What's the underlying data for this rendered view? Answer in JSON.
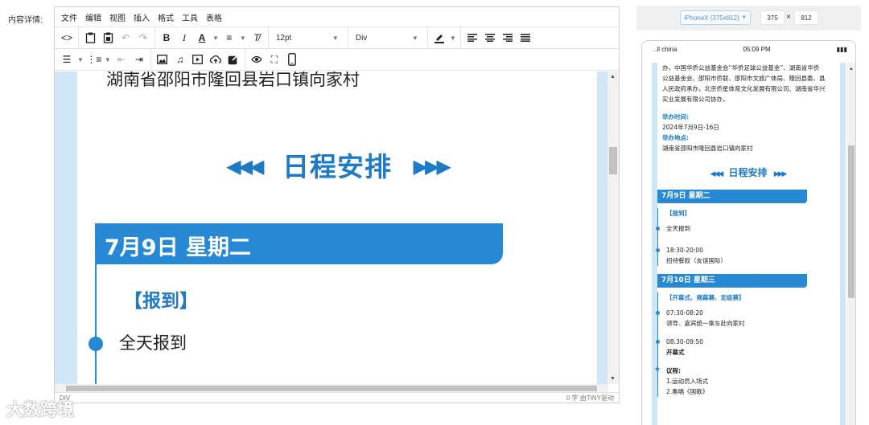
{
  "field_label": "内容详情:",
  "menubar": [
    "文件",
    "编辑",
    "视图",
    "插入",
    "格式",
    "工具",
    "表格"
  ],
  "toolbar": {
    "font_size": "12pt",
    "block_format": "Div"
  },
  "editor_content": {
    "address_line": "湖南省邵阳市隆回县岩口镇向家村",
    "schedule_title": "日程安排",
    "arrow_left": "◀◀◀",
    "arrow_right": "▶▶▶",
    "day_band": "7月9日  星期二",
    "tag": "【报到】",
    "item": "全天报到"
  },
  "statusbar": {
    "path": "DIV",
    "wordcount": "0 字  由TINY驱动"
  },
  "preview": {
    "device": "iPhoneX (375x812)",
    "width": "375",
    "x": "×",
    "height": "812",
    "status_left": "..ll china",
    "status_time": "05:09 PM",
    "status_right": "▮▮▮"
  },
  "phone_content": {
    "intro_lines": [
      "办，中国华侨公益基金会“华侨足球公益基金”、湖南省华侨",
      "公益基金会、邵阳市侨联、邵阳市文旅广体局、隆回县委、县",
      "人民政府承办，北京侨星体育文化发展有限公司、湖南省华兴",
      "实业发展有限公司协办。"
    ],
    "time_label": "举办时间:",
    "time_value": "2024年7月9日-16日",
    "place_label": "举办地点:",
    "place_value": "湖南省邵阳市隆回县岩口镇向家村",
    "schedule_title": "日程安排",
    "day1_band": "7月9日  星期二",
    "day1_tag": "【报到】",
    "day1_item1": "全天报到",
    "day1_item2_time": "18:30-20:00",
    "day1_item2_desc": "招待餐叙（友谊国际）",
    "day2_band": "7月10日  星期三",
    "day2_tag": "【开幕式、揭幕赛、定级赛】",
    "day2_item1_time": "07:30-08:20",
    "day2_item1_desc": "领导、嘉宾统一乘车赴向家村",
    "day2_item2_time": "08:30-09:50",
    "day2_item2_desc": "开幕式",
    "agenda_label": "议程:",
    "agenda_1": "1.运动员入场式",
    "agenda_2": "2.奏唱《国歌》"
  },
  "watermark": "大数跨境",
  "colors": {
    "accent": "#2789d3",
    "light_strip": "#cfe6f6"
  }
}
